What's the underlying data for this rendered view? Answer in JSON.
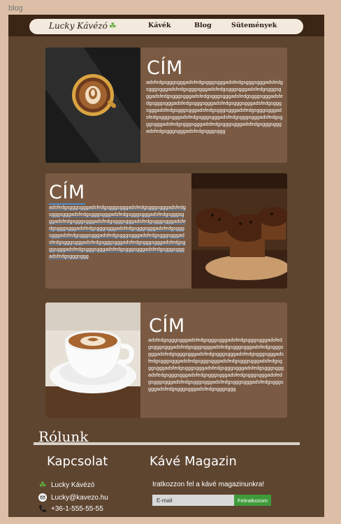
{
  "frame_label": "blog",
  "nav": {
    "logo_text": "Lucky Kávézó",
    "links": [
      "Kávék",
      "Blog",
      "Sütemények"
    ]
  },
  "cards": [
    {
      "title": "CÍM",
      "body": "adsfedgsgggsgggadsfedgsgggsgggadsfedgsgggsgggadsfedgsgggsgggadsfedgsgggsgggadsfedgsgggsgggadsfedgsgggsgggadsfedgsgggsgggadsfedgsgggsgggadsfedgsgggsgggadsfedgsgggsgggadsfedgsgggsgggadsfedgsgggsgggadsfedgsgggsgggadsfedgsgggsgggadsfedgsgggsgggadsfedgsgggsgggadsfedgsgggsgggadsfedgsgggsgggadsfedgsgggsgggadsfedgsgggsgggadsfedgsgggsgggadsfedgsgggsgggadsfedgsgggsgggadsfedgsgggsgggadsfedgsgggsggg",
      "image": "latte-art-top-view"
    },
    {
      "title": "CÍM",
      "body": "adsfedgsgggsgggadsfedgsgggsgggadsfedgsgggsgggadsfedgsgggsgggadsfedgsgggsgggadsfedgsgggsgggadsfedgsgggsgggadsfedgsgggsgggadsfedgsgggsgggadsfedgsgggsgggadsfedgsgggsgggadsfedgsgggsgggadsfedgsgggsgggadsfedgsgggsgggadsfedgsgggsgggadsfedgsgggsgggadsfedgsgggsgggadsfedgsgggsgggadsfedgsgggsgggadsfedgsgggsgggadsfedgsgggsgggadsfedgsgggsgggadsfedgsgggsgggadsfedgsgggsgggadsfedgsgggsggg",
      "image": "chocolate-muffins"
    },
    {
      "title": "CÍM",
      "body": "adsfedgsgggsgggadsfedgsgggsgggadsfedgsgggsgggadsfedgsgggsgggadsfedgsgggsgggadsfedgsgggsgggadsfedgsgggsgggadsfedgsgggsgggadsfedgsgggsgggadsfedgsgggsgggadsfedgsgggsgggadsfedgsgggsgggadsfedgsgggsgggadsfedgsgggsgggadsfedgsgggsgggadsfedgsgggsgggadsfedgsgggsgggadsfedgsgggsgggadsfedgsgggsgggadsfedgsgggsgggadsfedgsgggsgggadsfedgsgggsgggadsfedgsgggsgggadsfedgsgggsgggadsfedgsgggsgggadsfedgsgggsggg",
      "image": "cappuccino-cup-saucer"
    }
  ],
  "about": {
    "title": "Rólunk"
  },
  "footer": {
    "contact_title": "Kapcsolat",
    "contact_items": [
      {
        "icon": "clover-icon",
        "text": "Lucky Kávézó"
      },
      {
        "icon": "mail-icon",
        "text": "Lucky@kavezo.hu"
      },
      {
        "icon": "phone-icon",
        "text": "+36-1-555-55-55"
      }
    ],
    "magazine_title": "Kávé Magazin",
    "magazine_text": "Iratkozzon fel a kávé magazinunkra!",
    "email_placeholder": "E-mail",
    "subscribe_label": "Feliratkozom"
  },
  "colors": {
    "background": "#dcbfa6",
    "page": "#5e4530",
    "card": "#7a5a42",
    "topbar": "#3b2515",
    "button": "#3f9b3a"
  }
}
